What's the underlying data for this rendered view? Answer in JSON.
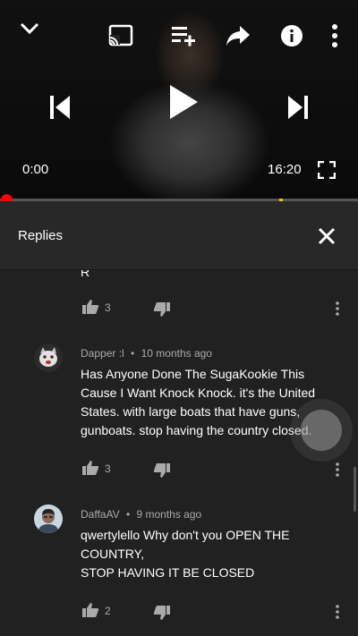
{
  "player": {
    "current_time": "0:00",
    "duration": "16:20",
    "progress": 0
  },
  "replies_panel": {
    "title": "Replies"
  },
  "truncated_comment": {
    "text_tail": "R",
    "like_count": "3"
  },
  "comments": [
    {
      "author": "Dapper :l",
      "age": "10 months ago",
      "lines": [
        "Has Anyone Done The SugaKookie This",
        "Cause I Want Knock Knock. it's the United",
        "States. with large boats that have guns,",
        "gunboats. stop having the country closed."
      ],
      "like_count": "3"
    },
    {
      "author": "DaffaAV",
      "age": "9 months ago",
      "lines": [
        "qwertylello Why don't you OPEN THE",
        "COUNTRY,",
        "STOP HAVING IT BE CLOSED"
      ],
      "like_count": "2"
    }
  ],
  "separator": "•",
  "colors": {
    "background": "#212121",
    "header": "#282828",
    "progress": "#ff0000",
    "meta_text": "#aaaaaa"
  }
}
